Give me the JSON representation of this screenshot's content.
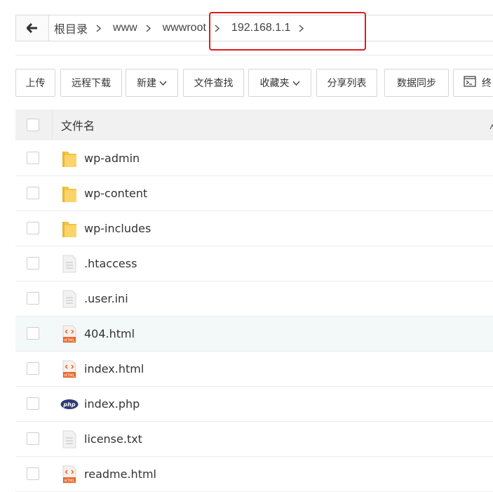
{
  "breadcrumb": {
    "items": [
      "根目录",
      "www",
      "wwwroot",
      "192.168.1.1"
    ]
  },
  "toolbar": {
    "upload": "上传",
    "remote_download": "远程下载",
    "new": "新建",
    "file_search": "文件查找",
    "favorites": "收藏夹",
    "share_list": "分享列表",
    "data_sync": "数据同步",
    "terminal": "终"
  },
  "table": {
    "header_name": "文件名",
    "files": [
      {
        "name": "wp-admin",
        "type": "folder"
      },
      {
        "name": "wp-content",
        "type": "folder"
      },
      {
        "name": "wp-includes",
        "type": "folder"
      },
      {
        "name": ".htaccess",
        "type": "text"
      },
      {
        "name": ".user.ini",
        "type": "text"
      },
      {
        "name": "404.html",
        "type": "html"
      },
      {
        "name": "index.html",
        "type": "html"
      },
      {
        "name": "index.php",
        "type": "php"
      },
      {
        "name": "license.txt",
        "type": "text"
      },
      {
        "name": "readme.html",
        "type": "html"
      }
    ]
  },
  "colors": {
    "highlight_border": "#e11b1b",
    "folder": "#f7c94b",
    "html_badge": "#e8672a",
    "php_badge": "#2d3a78",
    "hover_row": "#f3f9f8"
  }
}
